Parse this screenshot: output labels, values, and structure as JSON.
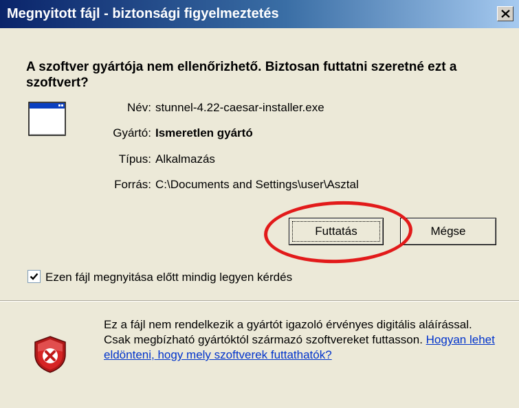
{
  "window": {
    "title": "Megnyitott fájl - biztonsági figyelmeztetés",
    "close_label": "Close"
  },
  "question": "A szoftver gyártója nem ellenőrizhető. Biztosan futtatni szeretné ezt a szoftvert?",
  "file_info": {
    "name_label": "Név:",
    "name_value": "stunnel-4.22-caesar-installer.exe",
    "publisher_label": "Gyártó:",
    "publisher_value": "Ismeretlen gyártó",
    "type_label": "Típus:",
    "type_value": "Alkalmazás",
    "from_label": "Forrás:",
    "from_value": "C:\\Documents and Settings\\user\\Asztal"
  },
  "buttons": {
    "run": "Futtatás",
    "cancel": "Mégse"
  },
  "checkbox": {
    "label": "Ezen fájl megnyitása előtt mindig legyen kérdés",
    "checked": true
  },
  "warning": {
    "text": "Ez a fájl nem rendelkezik a gyártót igazoló érvényes digitális aláírással. Csak megbízható gyártóktól származó szoftvereket futtasson. ",
    "link": "Hogyan lehet eldönteni, hogy mely szoftverek futtathatók?"
  },
  "colors": {
    "title_gradient_start": "#0a246a",
    "title_gradient_end": "#a6caf0",
    "dialog_bg": "#ece9d8",
    "highlight_ellipse": "#e21a1a",
    "link": "#0033cc"
  },
  "icons": [
    "close-icon",
    "application-window-icon",
    "checkmark-icon",
    "security-shield-icon"
  ]
}
